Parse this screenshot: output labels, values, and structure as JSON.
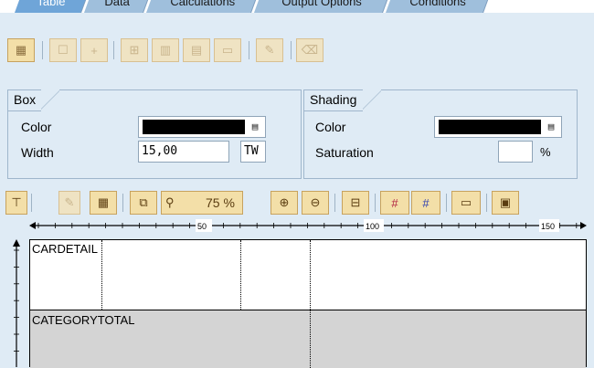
{
  "tabs": [
    {
      "label": "Table",
      "active": true
    },
    {
      "label": "Data",
      "active": false
    },
    {
      "label": "Calculations",
      "active": false
    },
    {
      "label": "Output Options",
      "active": false
    },
    {
      "label": "Conditions",
      "active": false
    }
  ],
  "box": {
    "title": "Box",
    "color_label": "Color",
    "color_value": "#000000",
    "width_label": "Width",
    "width_value": "15,00",
    "width_unit": "TW"
  },
  "shading": {
    "title": "Shading",
    "color_label": "Color",
    "color_value": "#000000",
    "saturation_label": "Saturation",
    "saturation_value": "",
    "saturation_unit": "%"
  },
  "zoom": {
    "value": "75 %"
  },
  "ruler": {
    "marks": [
      "50",
      "100",
      "150"
    ]
  },
  "table": {
    "row1_label": "CARDETAIL",
    "row2_label": "CATEGORYTOTAL"
  },
  "colors": {
    "active_tab": "#6fa5d8",
    "tab": "#9fbfdc",
    "background": "#dfebf5",
    "button": "#f3dfa8",
    "shade": "#d4d4d4"
  }
}
